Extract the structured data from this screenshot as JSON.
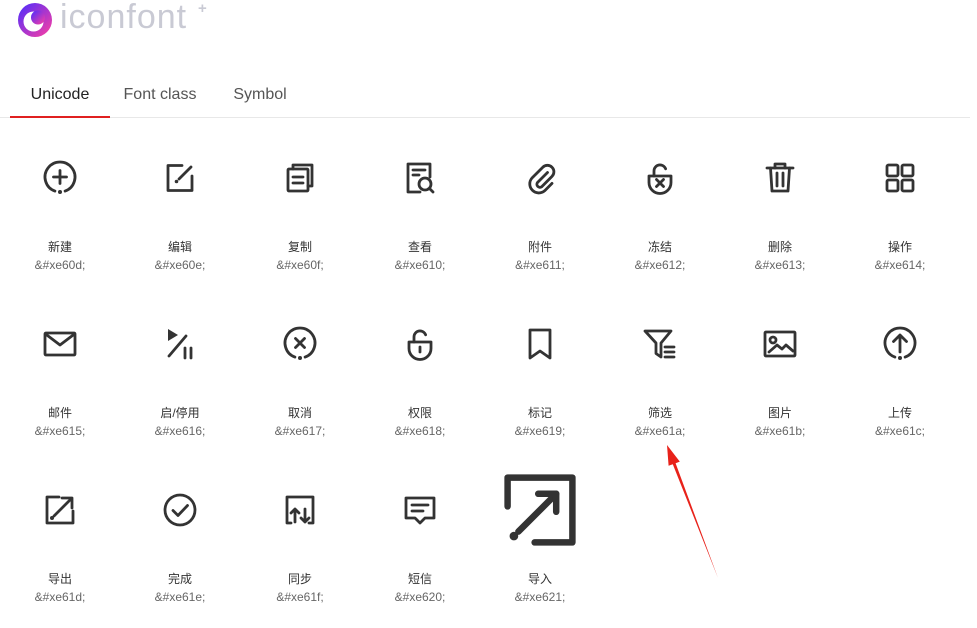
{
  "logo": {
    "text": "iconfont",
    "plus": "+"
  },
  "tabs": [
    {
      "label": "Unicode",
      "active": true
    },
    {
      "label": "Font class",
      "active": false
    },
    {
      "label": "Symbol",
      "active": false
    }
  ],
  "colors": {
    "accent": "#e02020",
    "icon": "#333333",
    "text": "#333333",
    "code": "#666666",
    "annotation": "#e8221a",
    "logo_gradient_start": "#4a2cff",
    "logo_gradient_end": "#ff3fa0"
  },
  "icons": [
    {
      "name": "新建",
      "code": "&#xe60d;",
      "icon": "add-circle-icon"
    },
    {
      "name": "编辑",
      "code": "&#xe60e;",
      "icon": "edit-icon"
    },
    {
      "name": "复制",
      "code": "&#xe60f;",
      "icon": "copy-icon"
    },
    {
      "name": "查看",
      "code": "&#xe610;",
      "icon": "view-document-icon"
    },
    {
      "name": "附件",
      "code": "&#xe611;",
      "icon": "paperclip-icon"
    },
    {
      "name": "冻结",
      "code": "&#xe612;",
      "icon": "lock-x-icon"
    },
    {
      "name": "删除",
      "code": "&#xe613;",
      "icon": "trash-icon"
    },
    {
      "name": "操作",
      "code": "&#xe614;",
      "icon": "grid-icon"
    },
    {
      "name": "邮件",
      "code": "&#xe615;",
      "icon": "mail-icon"
    },
    {
      "name": "启/停用",
      "code": "&#xe616;",
      "icon": "play-pause-icon"
    },
    {
      "name": "取消",
      "code": "&#xe617;",
      "icon": "close-circle-icon"
    },
    {
      "name": "权限",
      "code": "&#xe618;",
      "icon": "unlock-icon"
    },
    {
      "name": "标记",
      "code": "&#xe619;",
      "icon": "bookmark-icon"
    },
    {
      "name": "筛选",
      "code": "&#xe61a;",
      "icon": "filter-icon"
    },
    {
      "name": "图片",
      "code": "&#xe61b;",
      "icon": "image-icon"
    },
    {
      "name": "上传",
      "code": "&#xe61c;",
      "icon": "upload-icon"
    },
    {
      "name": "导出",
      "code": "&#xe61d;",
      "icon": "export-icon"
    },
    {
      "name": "完成",
      "code": "&#xe61e;",
      "icon": "check-circle-icon"
    },
    {
      "name": "同步",
      "code": "&#xe61f;",
      "icon": "sync-icon"
    },
    {
      "name": "短信",
      "code": "&#xe620;",
      "icon": "message-icon"
    },
    {
      "name": "导入",
      "code": "&#xe621;",
      "icon": "import-icon"
    }
  ]
}
